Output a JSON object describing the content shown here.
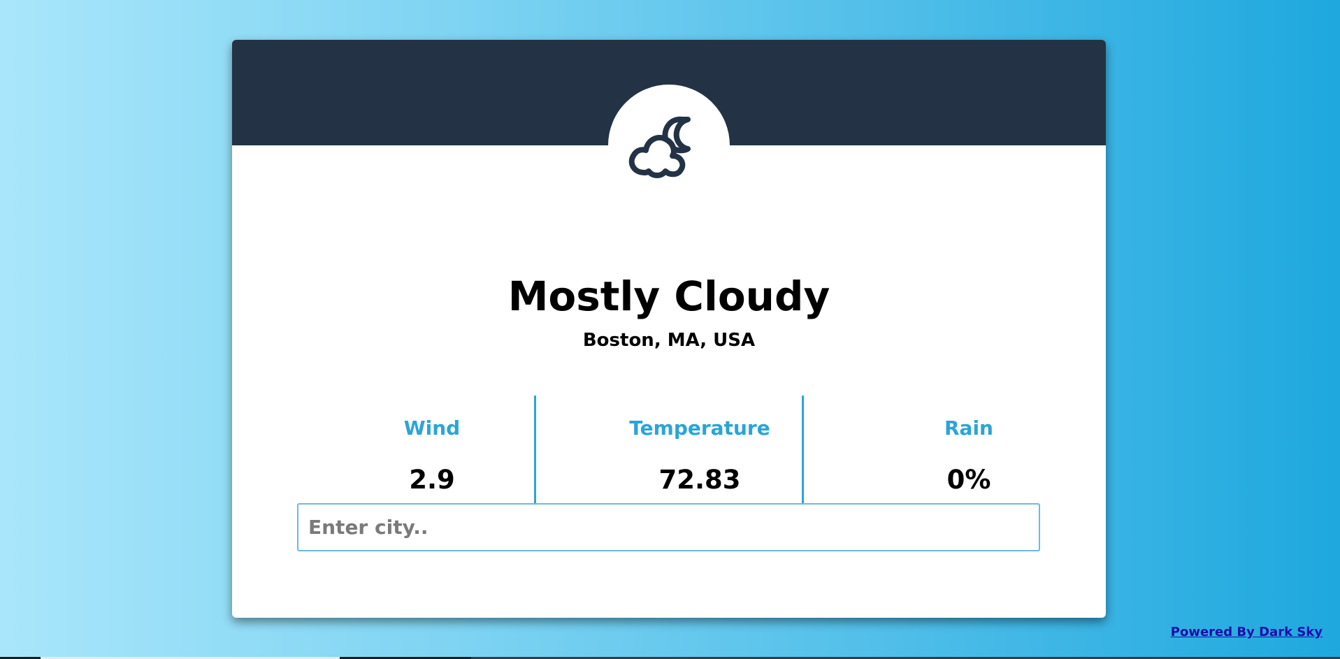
{
  "weather": {
    "summary": "Mostly Cloudy",
    "location": "Boston, MA, USA",
    "icon": "partly-cloudy-night-icon"
  },
  "stats": {
    "wind": {
      "label": "Wind",
      "value": "2.9"
    },
    "temperature": {
      "label": "Temperature",
      "value": "72.83"
    },
    "rain": {
      "label": "Rain",
      "value": "0%"
    }
  },
  "search": {
    "placeholder": "Enter city..",
    "value": ""
  },
  "footer": {
    "powered_by": "Powered By Dark Sky"
  },
  "colors": {
    "header": "#233345",
    "accent": "#2aa5d7",
    "background_start": "#a9e6fb",
    "background_end": "#1ea8de"
  }
}
